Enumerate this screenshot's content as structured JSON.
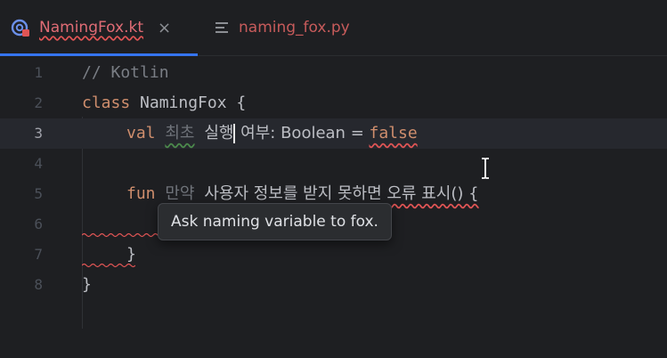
{
  "tabs": [
    {
      "label": "NamingFox.kt",
      "active": true,
      "icon": "kotlin-file-icon",
      "close": "×"
    },
    {
      "label": "naming_fox.py",
      "active": false,
      "icon": "text-file-icon"
    }
  ],
  "editor": {
    "lines": [
      {
        "number": "1",
        "text": "// Kotlin"
      },
      {
        "number": "2",
        "kw": "class",
        "rest": " NamingFox {"
      },
      {
        "number": "3",
        "kw": "val",
        "faded": "최초",
        "part1": "실행",
        "part2": " 여부: Boolean = ",
        "value": "false"
      },
      {
        "number": "4"
      },
      {
        "number": "5",
        "kw": "fun",
        "faded": "만약",
        "part1": "사용자 정보를 받지 못하면 오류 표시() {"
      },
      {
        "number": "6"
      },
      {
        "number": "7",
        "text": "}"
      },
      {
        "number": "8",
        "text": "}"
      }
    ],
    "current_line": 3
  },
  "tooltip": {
    "text": "Ask naming variable to fox."
  },
  "colors": {
    "background": "#1e1f22",
    "keyword": "#cf8e6d",
    "error": "#e05555",
    "accent": "#3574f0"
  }
}
